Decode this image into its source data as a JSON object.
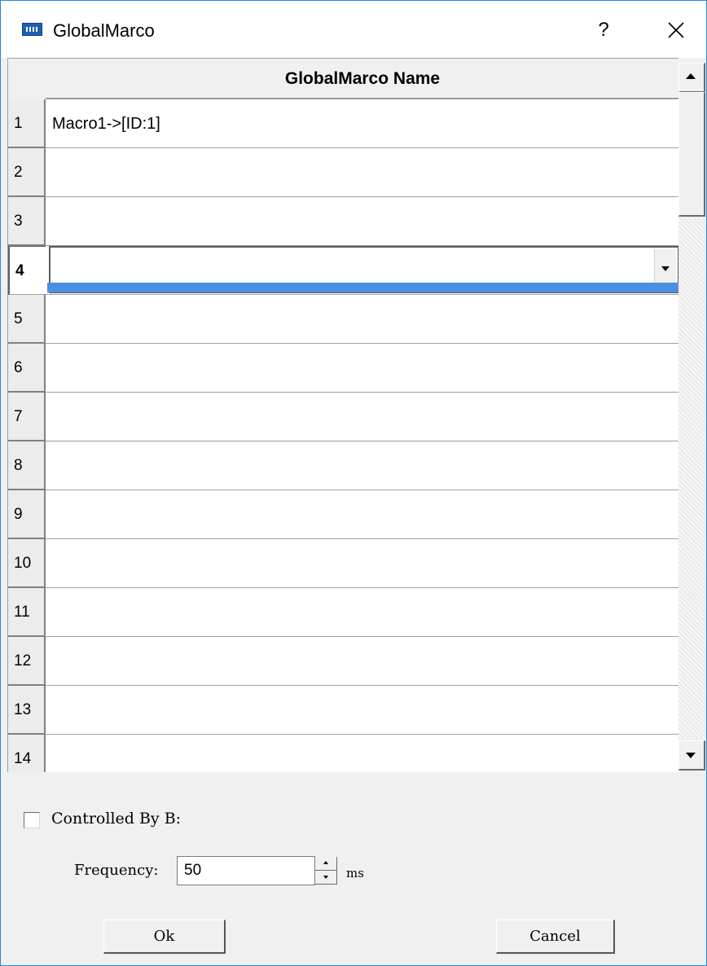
{
  "window": {
    "title": "GlobalMarco",
    "help_label": "?",
    "accent_color": "#1e8ae0"
  },
  "grid": {
    "column_header": "GlobalMarco Name",
    "rows": [
      {
        "num": "1",
        "value": "Macro1->[ID:1]"
      },
      {
        "num": "2",
        "value": ""
      },
      {
        "num": "3",
        "value": ""
      },
      {
        "num": "4",
        "value": ""
      },
      {
        "num": "5",
        "value": ""
      },
      {
        "num": "6",
        "value": ""
      },
      {
        "num": "7",
        "value": ""
      },
      {
        "num": "8",
        "value": ""
      },
      {
        "num": "9",
        "value": ""
      },
      {
        "num": "10",
        "value": ""
      },
      {
        "num": "11",
        "value": ""
      },
      {
        "num": "12",
        "value": ""
      },
      {
        "num": "13",
        "value": ""
      },
      {
        "num": "14",
        "value": ""
      }
    ],
    "current_row": "4",
    "selection_color": "#4a90e2"
  },
  "options": {
    "controlled_label": "Controlled By B:",
    "controlled_checked": false,
    "frequency_label": "Frequency:",
    "frequency_value": "50",
    "frequency_unit": "ms"
  },
  "buttons": {
    "ok": "Ok",
    "cancel": "Cancel"
  }
}
